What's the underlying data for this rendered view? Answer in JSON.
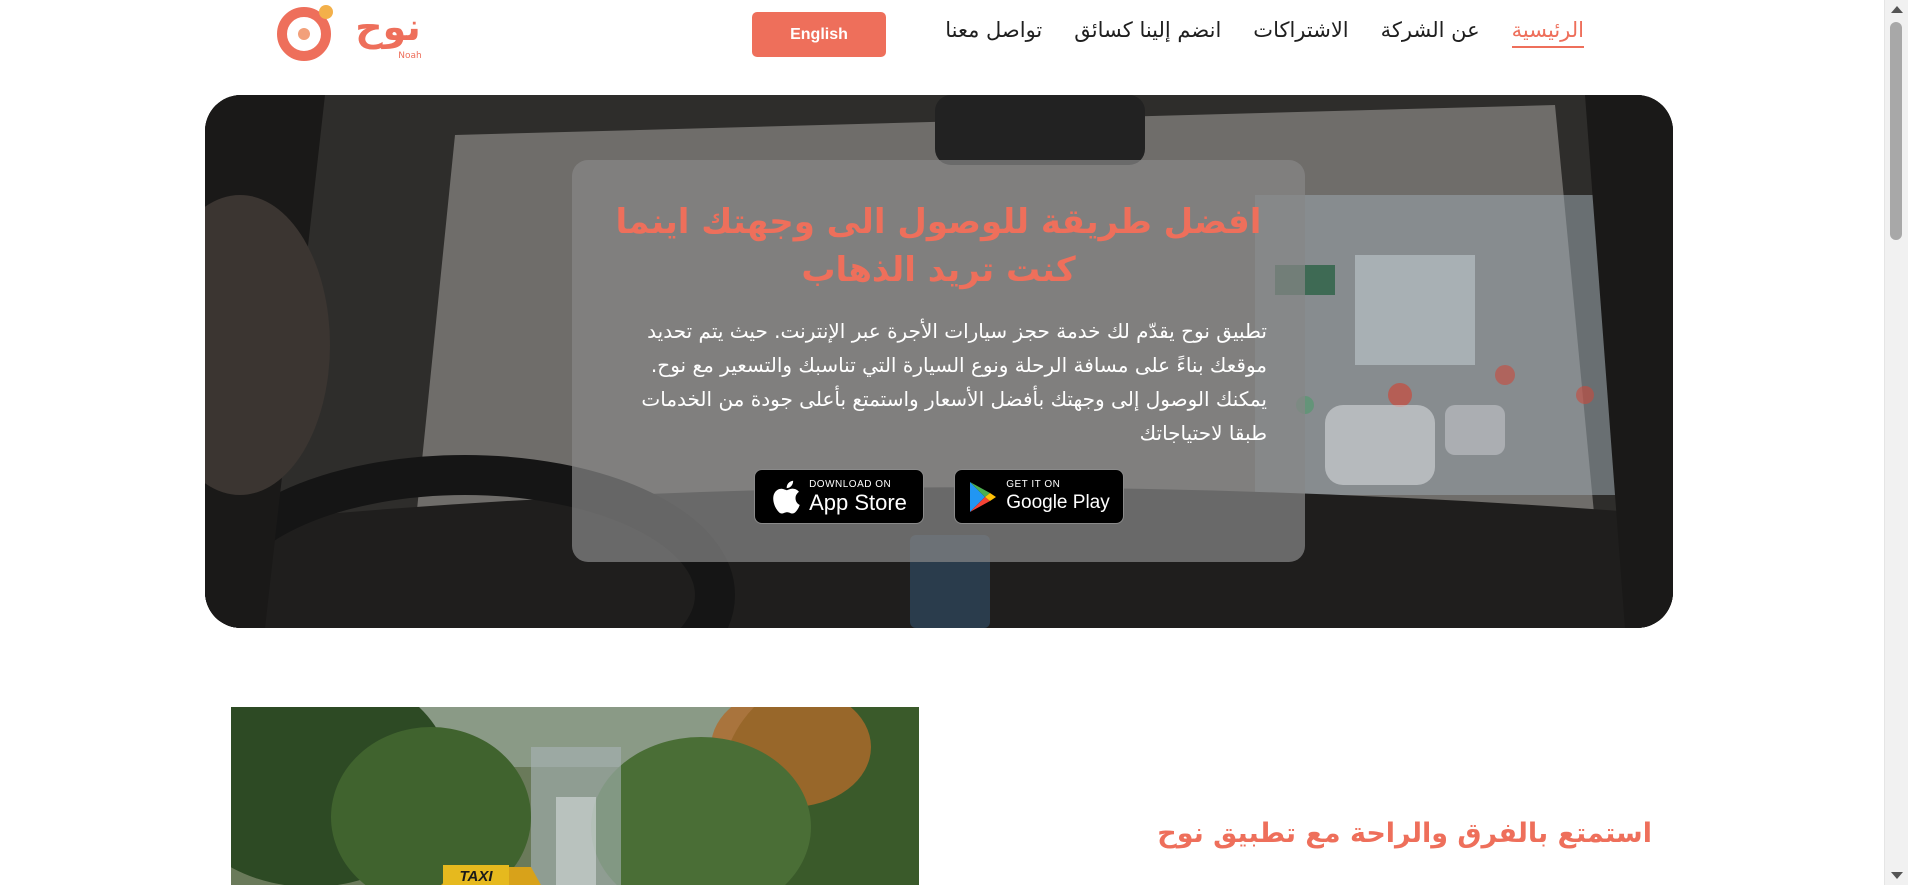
{
  "brand": {
    "logo_text": "نوح",
    "logo_subtext": "Noah",
    "accent_color": "#ee6f5b"
  },
  "nav": {
    "items": [
      {
        "label": "الرئيسية",
        "active": true
      },
      {
        "label": "عن الشركة",
        "active": false
      },
      {
        "label": "الاشتراكات",
        "active": false
      },
      {
        "label": "انضم إلينا كسائق",
        "active": false
      },
      {
        "label": "تواصل معنا",
        "active": false
      }
    ],
    "language_button": "English"
  },
  "hero": {
    "title": "افضل طريقة للوصول الى وجهتك اينما كنت تريد الذهاب",
    "description": "تطبيق نوح يقدّم لك خدمة حجز سيارات الأجرة عبر الإنترنت. حيث يتم تحديد موقعك بناءً على مسافة الرحلة ونوع السيارة التي تناسبك والتسعير مع نوح. يمكنك الوصول إلى وجهتك بأفضل الأسعار واستمتع بأعلى جودة من الخدمات طبقا لاحتياجاتك",
    "app_store": {
      "small": "DOWNLOAD ON",
      "big": "App Store",
      "icon": "apple-icon"
    },
    "google_play": {
      "small": "GET IT ON",
      "big": "Google Play",
      "icon": "google-play-icon"
    }
  },
  "feature": {
    "title": "استمتع بالفرق والراحة مع تطبيق نوح",
    "image_sign": "TAXI"
  }
}
